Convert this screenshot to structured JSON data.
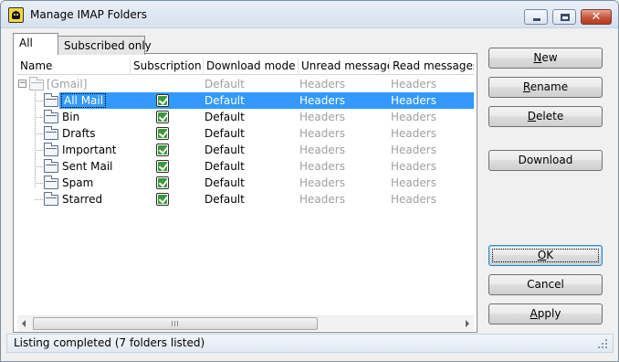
{
  "window": {
    "title": "Manage IMAP Folders",
    "close_glyph": "✕"
  },
  "tabs": [
    {
      "label": "All",
      "active": true
    },
    {
      "label": "Subscribed only",
      "active": false
    }
  ],
  "columns": {
    "name": "Name",
    "subscription": "Subscription",
    "download_mode": "Download mode",
    "unread": "Unread messages",
    "read": "Read messages"
  },
  "root": {
    "name": "[Gmail]",
    "download_mode": "Default",
    "unread": "Headers",
    "read": "Headers",
    "toggle": "−"
  },
  "folders": [
    {
      "name": "All Mail",
      "subscribed": true,
      "download_mode": "Default",
      "unread": "Headers",
      "read": "Headers",
      "selected": true
    },
    {
      "name": "Bin",
      "subscribed": true,
      "download_mode": "Default",
      "unread": "Headers",
      "read": "Headers",
      "selected": false
    },
    {
      "name": "Drafts",
      "subscribed": true,
      "download_mode": "Default",
      "unread": "Headers",
      "read": "Headers",
      "selected": false
    },
    {
      "name": "Important",
      "subscribed": true,
      "download_mode": "Default",
      "unread": "Headers",
      "read": "Headers",
      "selected": false
    },
    {
      "name": "Sent Mail",
      "subscribed": true,
      "download_mode": "Default",
      "unread": "Headers",
      "read": "Headers",
      "selected": false
    },
    {
      "name": "Spam",
      "subscribed": true,
      "download_mode": "Default",
      "unread": "Headers",
      "read": "Headers",
      "selected": false
    },
    {
      "name": "Starred",
      "subscribed": true,
      "download_mode": "Default",
      "unread": "Headers",
      "read": "Headers",
      "selected": false
    }
  ],
  "buttons": {
    "new": {
      "label": "New",
      "accel": "N",
      "rest": "ew"
    },
    "rename": {
      "label": "Rename",
      "accel": "R",
      "rest": "ename"
    },
    "delete": {
      "label": "Delete",
      "accel": "D",
      "rest": "elete"
    },
    "download": {
      "label": "Download"
    },
    "ok": {
      "label": "OK",
      "accel": "O",
      "rest": "K"
    },
    "cancel": {
      "label": "Cancel"
    },
    "apply": {
      "label": "Apply",
      "accel": "A",
      "rest": "pply"
    }
  },
  "status": {
    "text": "Listing completed (7 folders listed)"
  },
  "colors": {
    "selection": "#3399ff",
    "disabled_text": "#a0a0a0",
    "checkbox_green": "#3a9a3a"
  },
  "icons": [
    "app-icon",
    "minimize-icon",
    "maximize-icon",
    "close-icon",
    "folder-icon",
    "checkbox-checked-icon",
    "tree-collapse-icon",
    "scroll-left-icon",
    "scroll-right-icon",
    "resize-grip-icon"
  ]
}
